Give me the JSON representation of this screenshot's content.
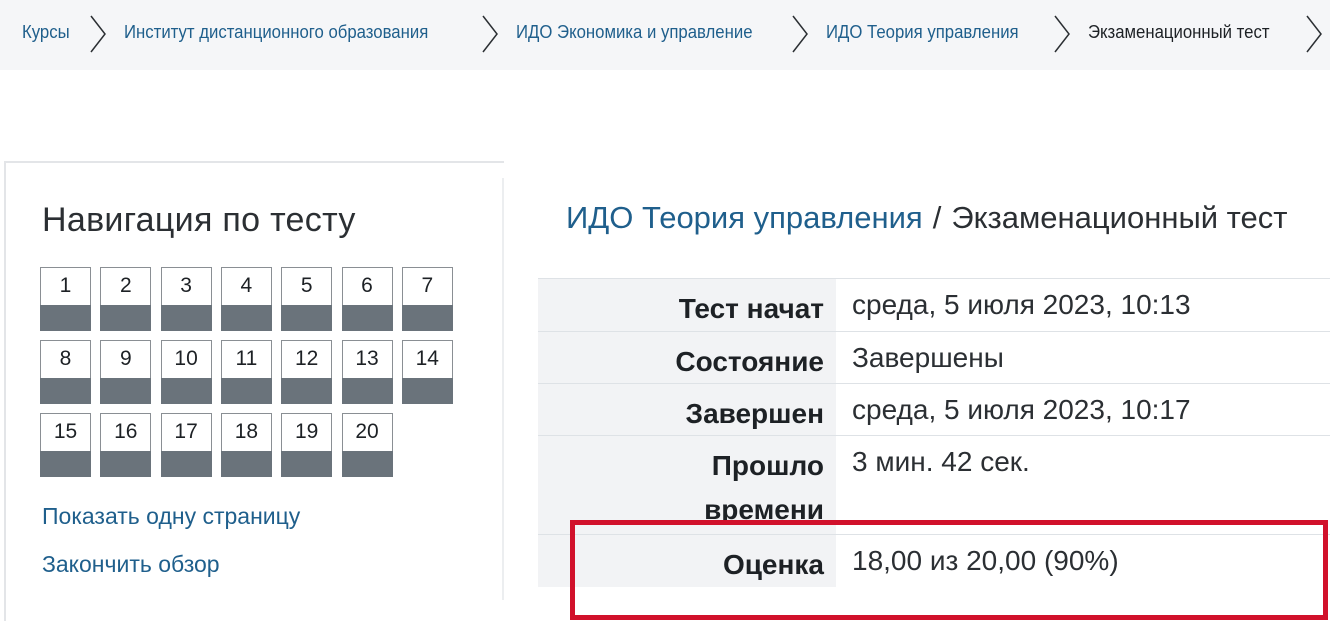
{
  "breadcrumb": [
    {
      "label": "Курсы"
    },
    {
      "label": "Институт дистанционного образования"
    },
    {
      "label": "ИДО Экономика и управление"
    },
    {
      "label": "ИДО Теория управления"
    },
    {
      "label": "Экзаменационный тест"
    }
  ],
  "quiz_nav": {
    "title": "Навигация по тесту",
    "questions": [
      "1",
      "2",
      "3",
      "4",
      "5",
      "6",
      "7",
      "8",
      "9",
      "10",
      "11",
      "12",
      "13",
      "14",
      "15",
      "16",
      "17",
      "18",
      "19",
      "20"
    ],
    "show_one_page": "Показать одну страницу",
    "finish_review": "Закончить обзор"
  },
  "page_header": {
    "course": "ИДО Теория управления",
    "separator": "/",
    "current": "Экзаменационный тест"
  },
  "summary": [
    {
      "label": "Тест начат",
      "value": "среда, 5 июля 2023, 10:13"
    },
    {
      "label": "Состояние",
      "value": "Завершены"
    },
    {
      "label": "Завершен",
      "value": "среда, 5 июля 2023, 10:17"
    },
    {
      "label": "Прошло времени",
      "value": "3 мин. 42 сек."
    },
    {
      "label": "Оценка",
      "value": "18,00 из 20,00 (90%)"
    }
  ],
  "colors": {
    "link": "#1f5f8c",
    "question_status_bar": "#6a737b",
    "highlight_border": "#d1112b"
  }
}
